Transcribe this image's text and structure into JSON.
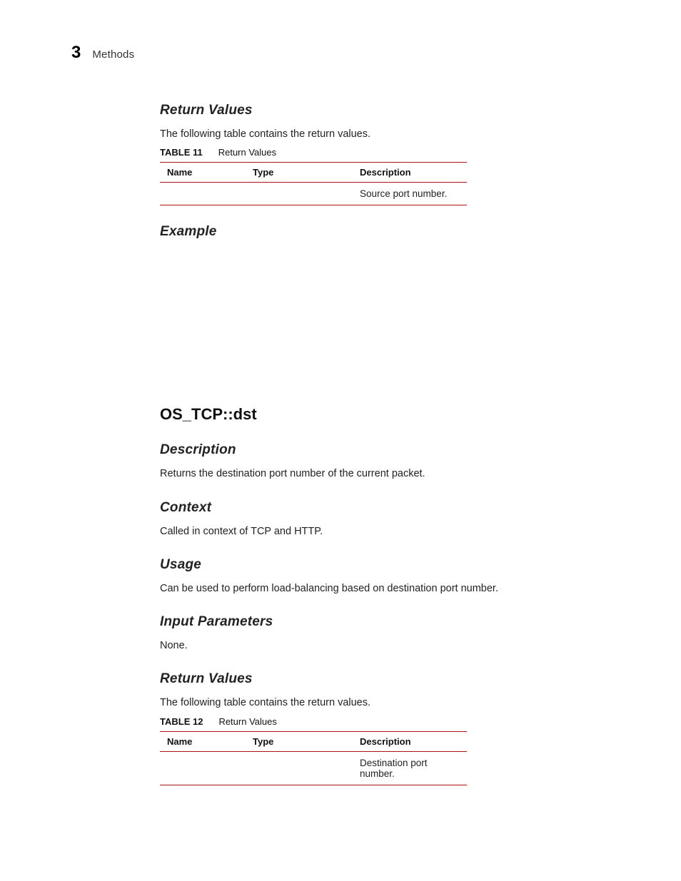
{
  "header": {
    "chapter_num": "3",
    "section_title": "Methods"
  },
  "section1": {
    "return_values_heading": "Return Values",
    "return_values_intro": "The following table contains the return values.",
    "table_label": "TABLE 11",
    "table_caption": "Return Values",
    "table": {
      "headers": {
        "name": "Name",
        "type": "Type",
        "description": "Description"
      },
      "row": {
        "name": "",
        "type": "",
        "description": "Source port number."
      }
    },
    "example_heading": "Example"
  },
  "section2": {
    "main_heading": "OS_TCP::dst",
    "description_heading": "Description",
    "description_text": "Returns the destination port number of the current packet.",
    "context_heading": "Context",
    "context_text": "Called in context of TCP and HTTP.",
    "usage_heading": "Usage",
    "usage_text": "Can be used to perform load-balancing based on destination port number.",
    "input_params_heading": "Input Parameters",
    "input_params_text": "None.",
    "return_values_heading": "Return Values",
    "return_values_intro": "The following table contains the return values.",
    "table_label": "TABLE 12",
    "table_caption": "Return Values",
    "table": {
      "headers": {
        "name": "Name",
        "type": "Type",
        "description": "Description"
      },
      "row": {
        "name": "",
        "type": "",
        "description": "Destination port number."
      }
    }
  }
}
